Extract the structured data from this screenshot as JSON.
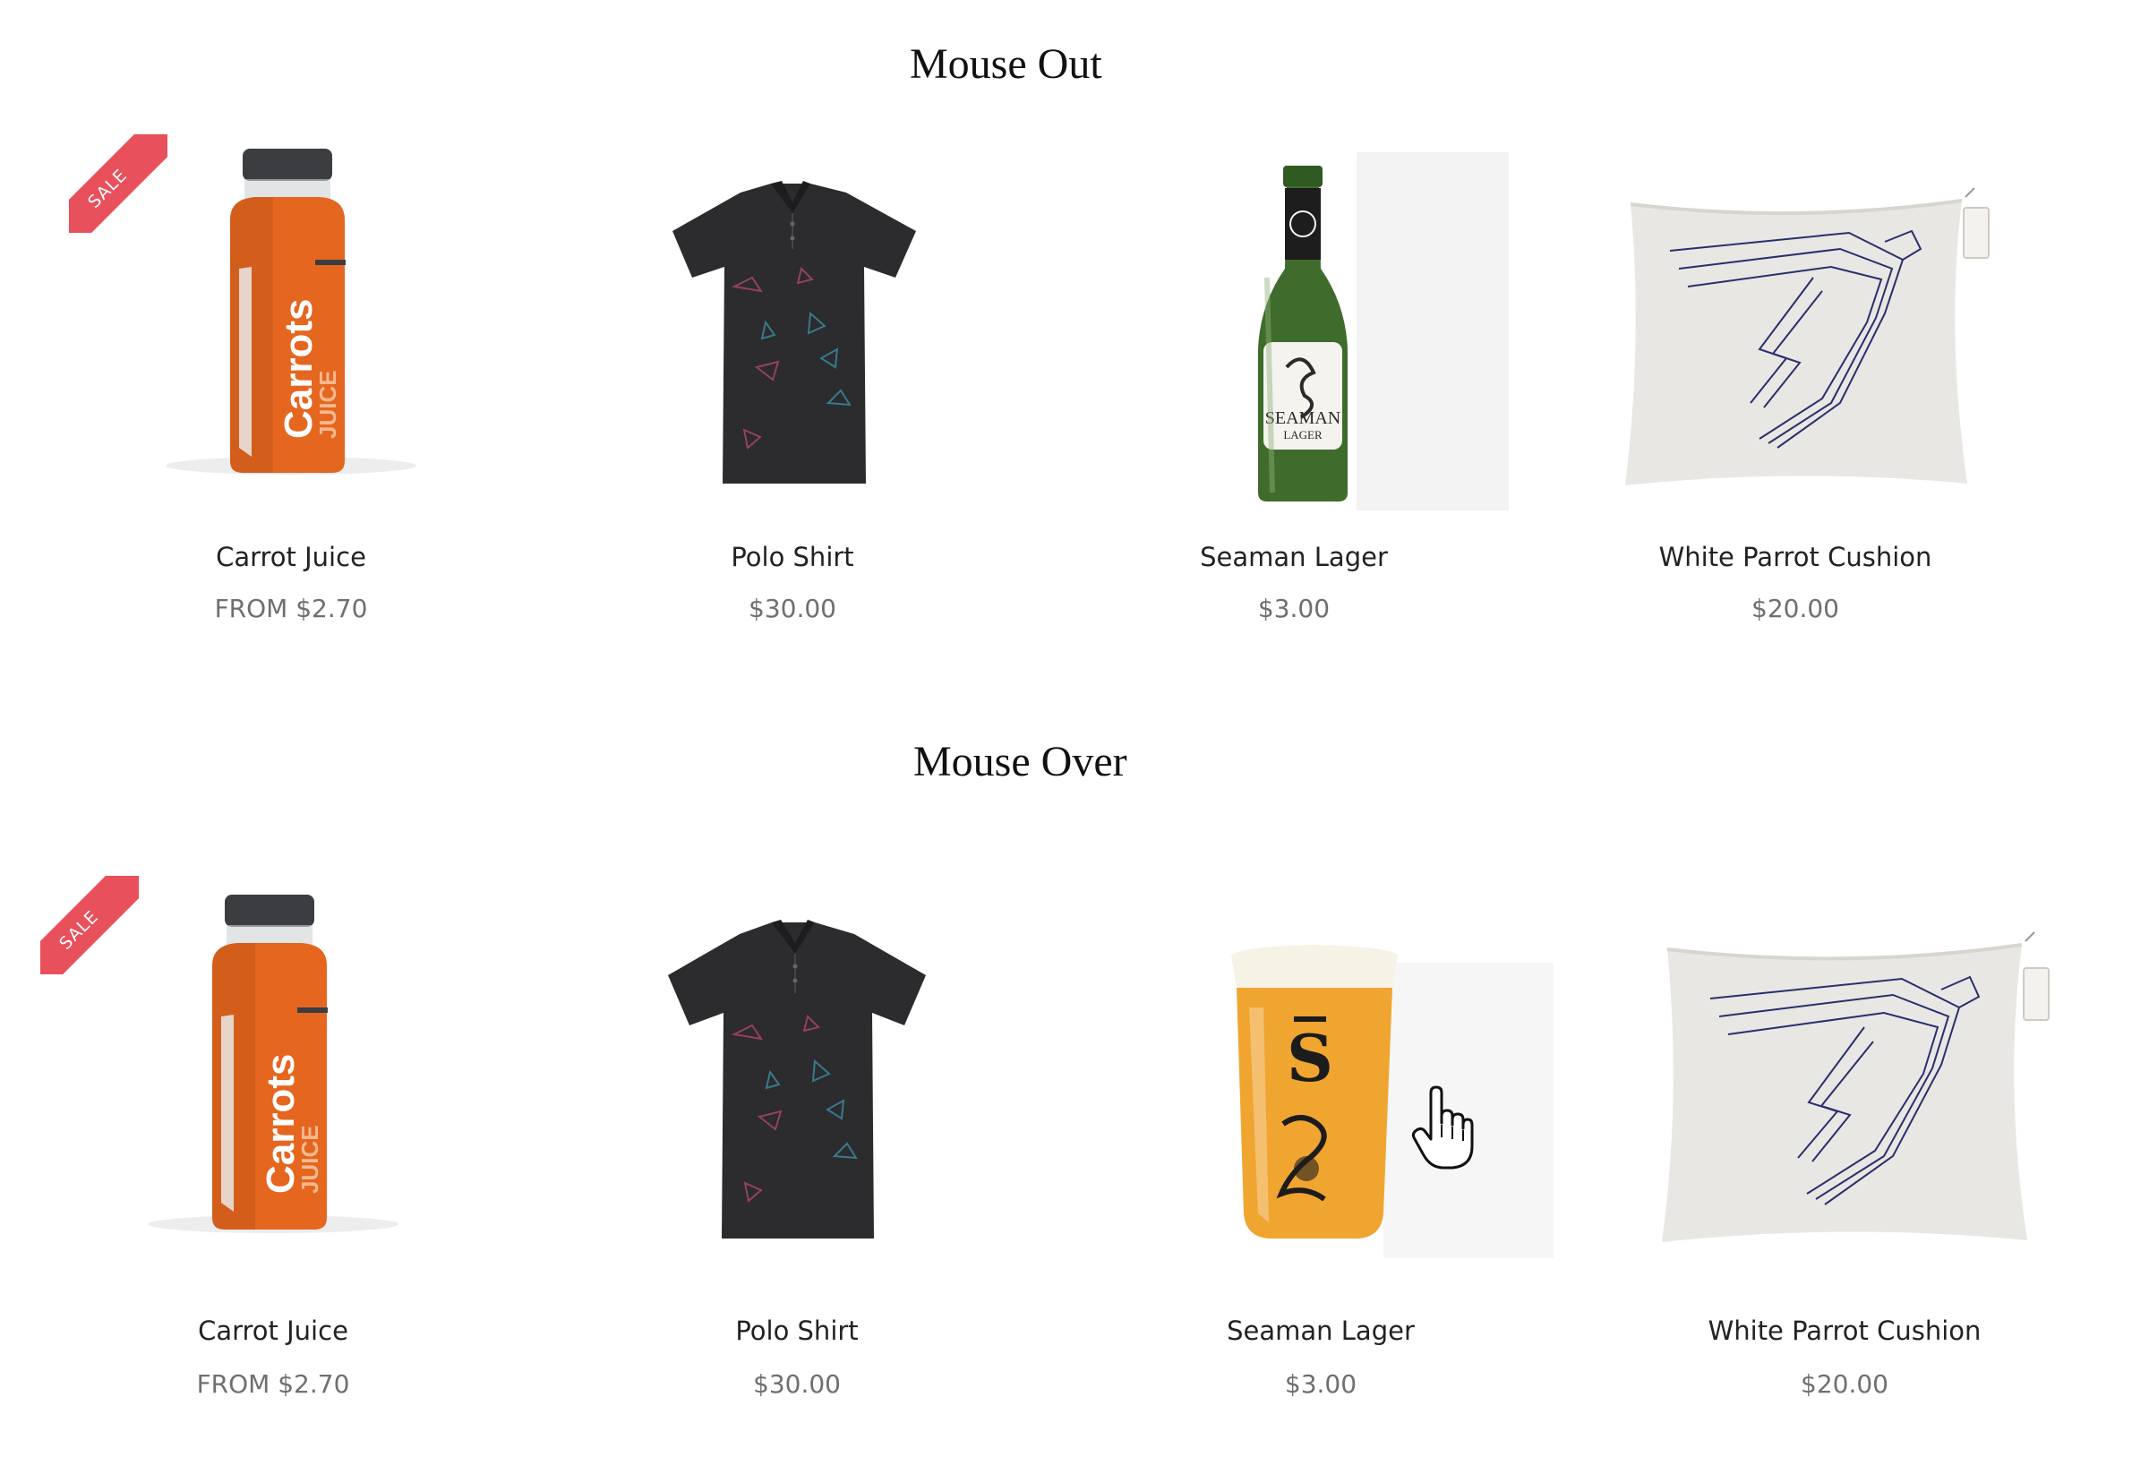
{
  "sections": {
    "mouse_out_title": "Mouse Out",
    "mouse_over_title": "Mouse Over"
  },
  "badges": {
    "sale": "SALE"
  },
  "mouse_out_products": [
    {
      "name": "Carrot Juice",
      "price": "FROM $2.70"
    },
    {
      "name": "Polo Shirt",
      "price": "$30.00"
    },
    {
      "name": "Seaman Lager",
      "price": "$3.00"
    },
    {
      "name": "White Parrot Cushion",
      "price": "$20.00"
    }
  ],
  "mouse_over_products": [
    {
      "name": "Carrot Juice",
      "price": "FROM $2.70"
    },
    {
      "name": "Polo Shirt",
      "price": "$30.00"
    },
    {
      "name": "Seaman Lager",
      "price": "$3.00"
    },
    {
      "name": "White Parrot Cushion",
      "price": "$20.00"
    }
  ],
  "product_art": {
    "bottle_brand": "Carrots",
    "bottle_sub": "JUICE",
    "lager_label_top": "SEAMAN",
    "lager_label_bottom": "LAGER",
    "glass_logo": "S"
  },
  "icons": [
    "sale-ribbon",
    "hand-pointer-icon"
  ],
  "colors": {
    "sale_ribbon": "#e8505b",
    "juice_orange": "#e5661f",
    "shirt": "#2c2b2e",
    "bottle_green": "#3f6b2c",
    "beer_amber": "#f0a531",
    "cushion": "#e9e7e3",
    "parrot_line": "#2a2e6e"
  }
}
